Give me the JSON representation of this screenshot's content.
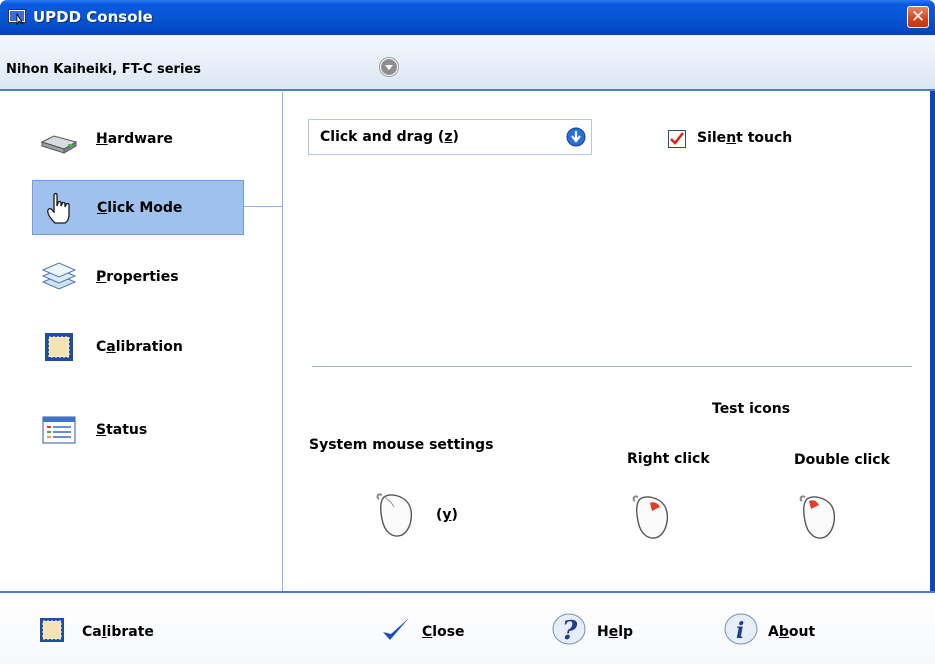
{
  "window": {
    "title": "UPDD Console",
    "close_glyph": "✕"
  },
  "device": {
    "name": "Nihon Kaiheiki, FT-C series"
  },
  "sidebar": {
    "items": [
      {
        "label_pre": "",
        "label_u": "H",
        "label_post": "ardware",
        "icon": "hardware-icon"
      },
      {
        "label_pre": "",
        "label_u": "C",
        "label_post": "lick Mode",
        "icon": "hand-pointer-icon",
        "active": true
      },
      {
        "label_pre": "",
        "label_u": "P",
        "label_post": "roperties",
        "icon": "layers-icon"
      },
      {
        "label_pre": "C",
        "label_u": "a",
        "label_post": "libration",
        "icon": "calibration-icon"
      },
      {
        "label_pre": "",
        "label_u": "S",
        "label_post": "tatus",
        "icon": "status-icon"
      }
    ]
  },
  "main": {
    "click_mode": {
      "pre": "Click and drag (",
      "u": "z",
      "post": ")"
    },
    "silent_touch": {
      "pre": "Sile",
      "u": "n",
      "post": "t touch",
      "checked": true
    },
    "system_mouse_settings": "System mouse settings",
    "system_mouse_shortcut": {
      "pre": "(",
      "u": "y",
      "post": ")"
    },
    "test_icons": "Test icons",
    "right_click": "Right click",
    "double_click": "Double click"
  },
  "footer": {
    "calibrate": {
      "pre": "Ca",
      "u": "l",
      "post": "ibrate"
    },
    "close": {
      "pre": "",
      "u": "C",
      "post": "lose"
    },
    "help": {
      "pre": "H",
      "u": "e",
      "post": "lp"
    },
    "about": {
      "pre": "A",
      "u": "b",
      "post": "out"
    }
  },
  "colors": {
    "titlebar": "#0756d6",
    "accent": "#4d7fd0",
    "active_nav": "#9ec1ee"
  }
}
